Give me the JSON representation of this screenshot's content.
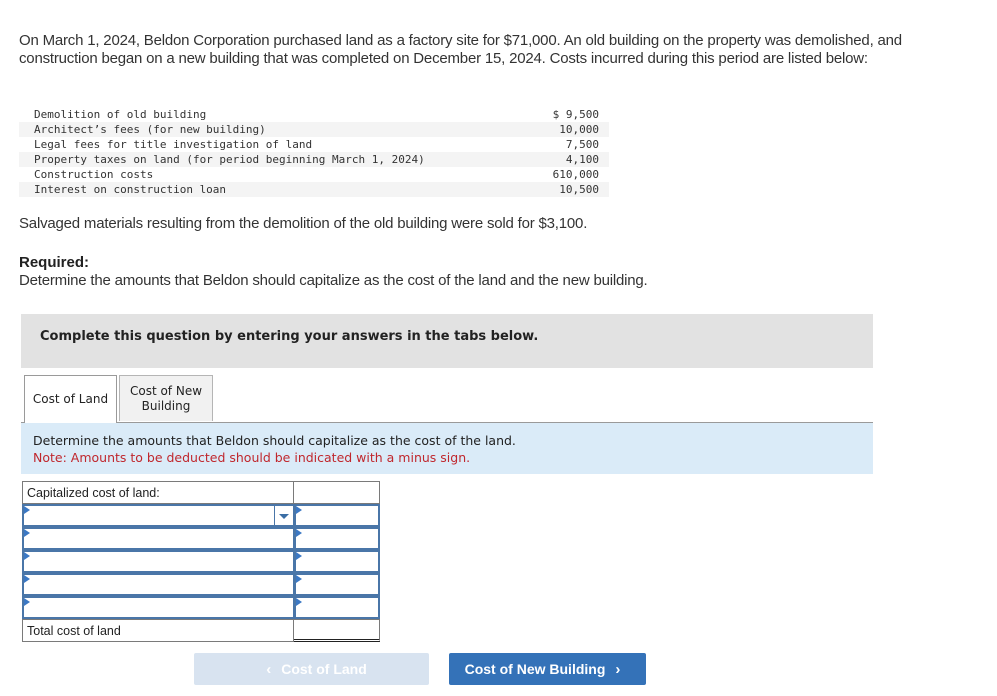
{
  "problem": {
    "intro": "On March 1, 2024, Beldon Corporation purchased land as a factory site for $71,000. An old building on the property was demolished, and construction began on a new building that was completed on December 15, 2024. Costs incurred during this period are listed below:",
    "costs": [
      {
        "label": "Demolition of old building",
        "amount": "$ 9,500"
      },
      {
        "label": "Architect’s fees (for new building)",
        "amount": "10,000"
      },
      {
        "label": "Legal fees for title investigation of land",
        "amount": "7,500"
      },
      {
        "label": "Property taxes on land (for period beginning March 1, 2024)",
        "amount": "4,100"
      },
      {
        "label": "Construction costs",
        "amount": "610,000"
      },
      {
        "label": "Interest on construction loan",
        "amount": "10,500"
      }
    ],
    "salvage": "Salvaged materials resulting from the demolition of the old building were sold for $3,100.",
    "required_label": "Required:",
    "required_text": "Determine the amounts that Beldon should capitalize as the cost of the land and the new building."
  },
  "banner": "Complete this question by entering your answers in the tabs below.",
  "tabs": [
    {
      "label": "Cost of Land",
      "active": true
    },
    {
      "label": "Cost of New Building",
      "active": false
    }
  ],
  "instructions": {
    "line1": "Determine the amounts that Beldon should capitalize as the cost of the land.",
    "note": "Note: Amounts to be deducted should be indicated with a minus sign."
  },
  "worksheet": {
    "header": "Capitalized cost of land:",
    "rows": [
      {
        "label": "",
        "amount": ""
      },
      {
        "label": "",
        "amount": ""
      },
      {
        "label": "",
        "amount": ""
      },
      {
        "label": "",
        "amount": ""
      },
      {
        "label": "",
        "amount": ""
      }
    ],
    "total_label": "Total cost of land",
    "total_value": ""
  },
  "nav": {
    "prev_label": "Cost of Land",
    "next_label": "Cost of New Building"
  },
  "colors": {
    "accent": "#3472b8",
    "note_red": "#c0272d",
    "instr_bg": "#daebf8",
    "banner_bg": "#e2e2e2"
  }
}
